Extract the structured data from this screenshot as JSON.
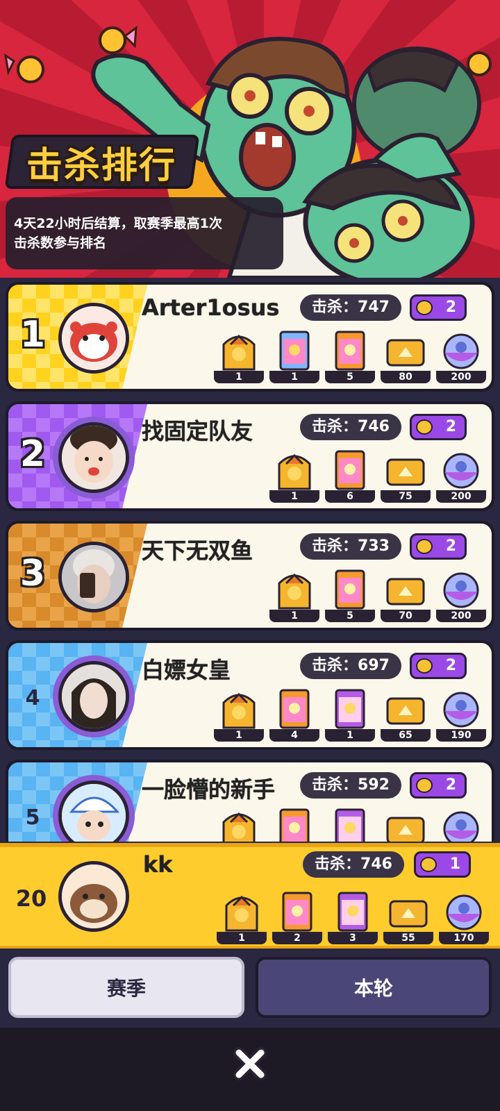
{
  "banner": {
    "title": "击杀排行",
    "info_line1": "4天22小时后结算，取赛季最高1次",
    "info_line2": "击杀数参与排名"
  },
  "ranks": [
    {
      "rank": "1",
      "name": "Arter1osus",
      "kills": "击杀：747",
      "medals": "2",
      "rewards": [
        {
          "kind": "chest",
          "count": "1"
        },
        {
          "kind": "card-blue",
          "count": "1"
        },
        {
          "kind": "card-orange",
          "count": "5"
        },
        {
          "kind": "ticket",
          "count": "80"
        },
        {
          "kind": "capsule",
          "count": "200"
        }
      ]
    },
    {
      "rank": "2",
      "name": "找固定队友",
      "kills": "击杀：746",
      "medals": "2",
      "rewards": [
        {
          "kind": "chest",
          "count": "1"
        },
        {
          "kind": "card-orange",
          "count": "6"
        },
        {
          "kind": "ticket",
          "count": "75"
        },
        {
          "kind": "capsule",
          "count": "200"
        }
      ]
    },
    {
      "rank": "3",
      "name": "天下无双鱼",
      "kills": "击杀：733",
      "medals": "2",
      "rewards": [
        {
          "kind": "chest",
          "count": "1"
        },
        {
          "kind": "card-orange",
          "count": "5"
        },
        {
          "kind": "ticket",
          "count": "70"
        },
        {
          "kind": "capsule",
          "count": "200"
        }
      ]
    },
    {
      "rank": "4",
      "name": "白嫖女皇",
      "kills": "击杀：697",
      "medals": "2",
      "rewards": [
        {
          "kind": "chest",
          "count": "1"
        },
        {
          "kind": "card-orange",
          "count": "4"
        },
        {
          "kind": "card-purple",
          "count": "1"
        },
        {
          "kind": "ticket",
          "count": "65"
        },
        {
          "kind": "capsule",
          "count": "190"
        }
      ]
    },
    {
      "rank": "5",
      "name": "一脸懵的新手",
      "kills": "击杀：592",
      "medals": "2",
      "rewards": [
        {
          "kind": "chest",
          "count": ""
        },
        {
          "kind": "card-orange",
          "count": ""
        },
        {
          "kind": "card-purple",
          "count": ""
        },
        {
          "kind": "ticket",
          "count": ""
        },
        {
          "kind": "capsule",
          "count": ""
        }
      ]
    }
  ],
  "me": {
    "rank": "20",
    "name": "kk",
    "kills": "击杀：746",
    "medals": "1",
    "rewards": [
      {
        "kind": "chest",
        "count": "1"
      },
      {
        "kind": "card-orange",
        "count": "2"
      },
      {
        "kind": "card-purple",
        "count": "3"
      },
      {
        "kind": "ticket",
        "count": "55"
      },
      {
        "kind": "capsule",
        "count": "170"
      }
    ]
  },
  "tabs": {
    "season": "赛季",
    "round": "本轮"
  },
  "colors": {
    "rank1": "#ffd21f",
    "rank2": "#a05af0",
    "rank3": "#d98a2a",
    "rank_other": "#58b4f2",
    "my_bar": "#ffcc2e"
  }
}
